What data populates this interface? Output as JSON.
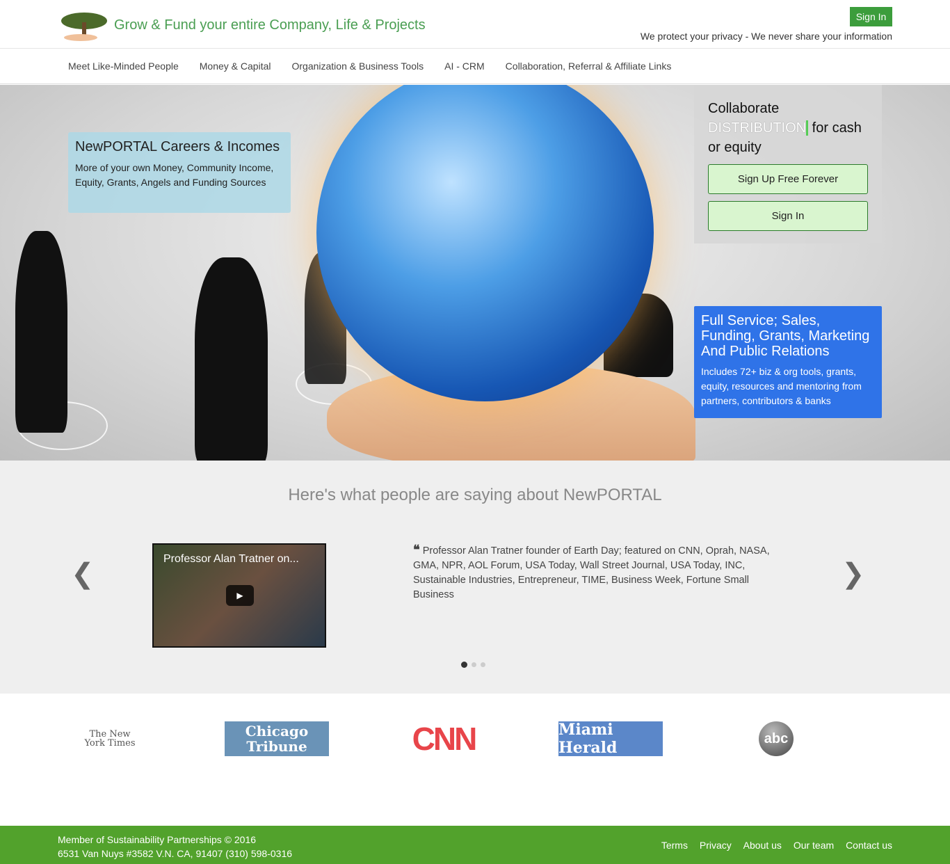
{
  "header": {
    "tagline": "Grow & Fund your entire Company, Life & Projects",
    "signin": "Sign In",
    "privacy": "We protect your privacy - We never share your information"
  },
  "nav": [
    "Meet Like-Minded People",
    "Money & Capital",
    "Organization & Business Tools",
    "AI - CRM",
    "Collaboration, Referral & Affiliate Links"
  ],
  "hero": {
    "careers": {
      "title": "NewPORTAL Careers & Incomes",
      "text": "More of your own Money, Community Income, Equity, Grants, Angels and Funding Sources"
    },
    "collab": {
      "line1": "Collaborate",
      "rotating": "DISTRIBUTION",
      "line2": " for cash",
      "line3": "or equity",
      "signup": "Sign Up Free Forever",
      "signin": "Sign In"
    },
    "service": {
      "title": "Full Service; Sales, Funding, Grants, Marketing And Public Relations",
      "text": "Includes 72+ biz & org tools, grants, equity, resources and mentoring from partners, contributors & banks"
    }
  },
  "testimonials": {
    "heading": "Here's what people are saying about NewPORTAL",
    "video_title": "Professor Alan Tratner on...",
    "quote": "Professor Alan Tratner founder of Earth Day; featured on CNN, Oprah, NASA, GMA, NPR, AOL Forum, USA Today, Wall Street Journal, USA Today, INC, Sustainable Industries, Entrepreneur, TIME, Business Week, Fortune Small Business",
    "active_slide": 1,
    "slide_count": 3
  },
  "press": {
    "nyt": "The New York Times",
    "chicago": "Chicago Tribune",
    "cnn": "CNN",
    "miami": "Miami Herald",
    "abc": "abc"
  },
  "footer": {
    "line1": "Member of Sustainability Partnerships © 2016",
    "line2": "6531 Van Nuys #3582 V.N. CA, 91407 (310) 598-0316",
    "links": [
      "Terms",
      "Privacy",
      "About us",
      "Our team",
      "Contact us"
    ]
  }
}
